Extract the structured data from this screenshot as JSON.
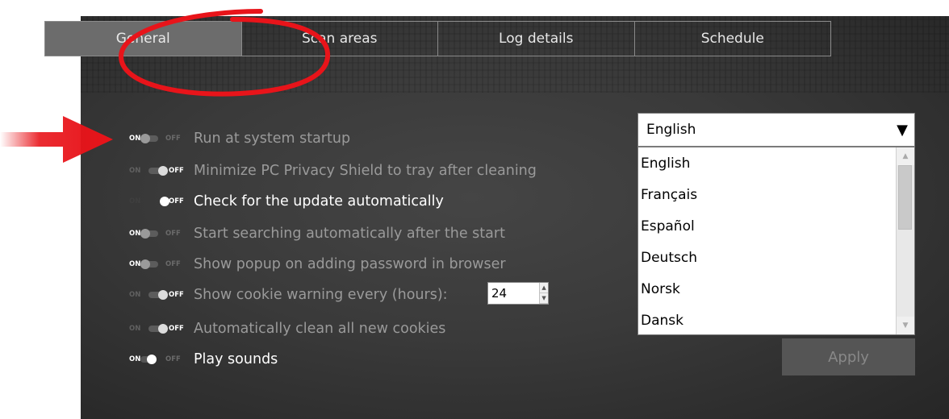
{
  "tabs": [
    {
      "label": "General",
      "active": true
    },
    {
      "label": "Scan areas",
      "active": false
    },
    {
      "label": "Log details",
      "active": false
    },
    {
      "label": "Schedule",
      "active": false
    }
  ],
  "toggle_text": {
    "on": "ON",
    "off": "OFF"
  },
  "options": [
    {
      "label": "Run at system startup",
      "state": "on"
    },
    {
      "label": "Minimize PC Privacy Shield to tray after cleaning",
      "state": "off"
    },
    {
      "label": "Check for the update automatically",
      "state": "off"
    },
    {
      "label": "Start searching automatically after the start",
      "state": "on"
    },
    {
      "label": "Show popup on adding password in browser",
      "state": "on"
    },
    {
      "label": "Show cookie warning every (hours):",
      "state": "off"
    },
    {
      "label": "Automatically clean all new cookies",
      "state": "off"
    },
    {
      "label": "Play sounds",
      "state": "on"
    }
  ],
  "cookie_hours": "24",
  "language": {
    "selected": "English",
    "options": [
      "English",
      "Français",
      "Español",
      "Deutsch",
      "Norsk",
      "Dansk"
    ]
  },
  "apply_label": "Apply",
  "colors": {
    "panel_bg": "#3a3a3a",
    "active_tab": "#6c6c6c",
    "annotation_red": "#e8141a"
  },
  "icons": {
    "dropdown_arrow": "triangle-down-icon",
    "annotation_arrow": "red-arrow-icon",
    "annotation_circle": "red-ellipse"
  }
}
